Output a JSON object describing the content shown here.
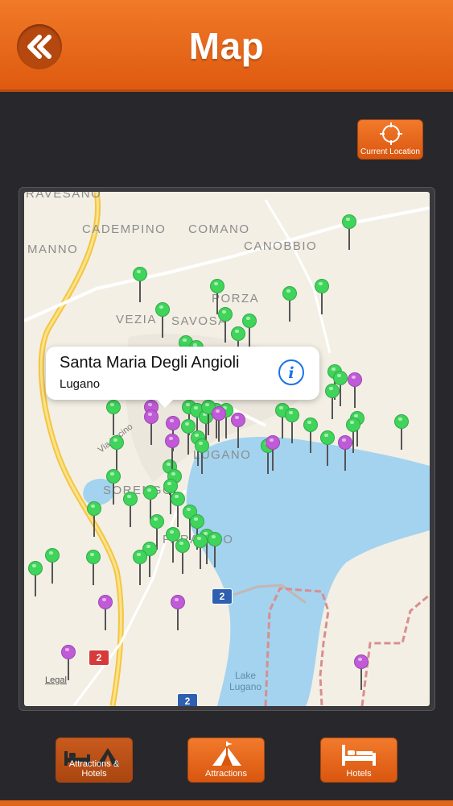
{
  "header": {
    "title": "Map",
    "back_icon": "double-chevron-left-icon"
  },
  "current_location": {
    "label": "Current Location",
    "icon": "crosshair-icon"
  },
  "map": {
    "places": {
      "ravesano": "RAVESANO",
      "cadempino": "CADEMPINO",
      "comano": "COMANO",
      "manno": "MANNO",
      "canobbio": "CANOBBIO",
      "porza": "PORZA",
      "vezia": "VEZIA",
      "savosa": "SAVOSA",
      "lugano": "LUGANO",
      "sorengo": "SORENGO",
      "paradiso": "PARADISO",
      "via_lucino": "Via Lucino",
      "lake": "Lake\nLugano"
    },
    "route_shields": [
      "2",
      "2",
      "2"
    ],
    "legal": "Legal",
    "colors": {
      "water": "#a3d3ef",
      "green_pin": "#3fd45a",
      "purple_pin": "#c05ad8",
      "highway": "#f4c542"
    }
  },
  "callout": {
    "title": "Santa Maria Degli Angioli",
    "subtitle": "Lugano",
    "info_icon": "info-icon"
  },
  "tabs": [
    {
      "label": "Attractions & Hotels",
      "icon": "bed-and-tent-icon",
      "selected": true
    },
    {
      "label": "Attractions",
      "icon": "tent-icon",
      "selected": false
    },
    {
      "label": "Hotels",
      "icon": "bed-icon",
      "selected": false
    }
  ]
}
